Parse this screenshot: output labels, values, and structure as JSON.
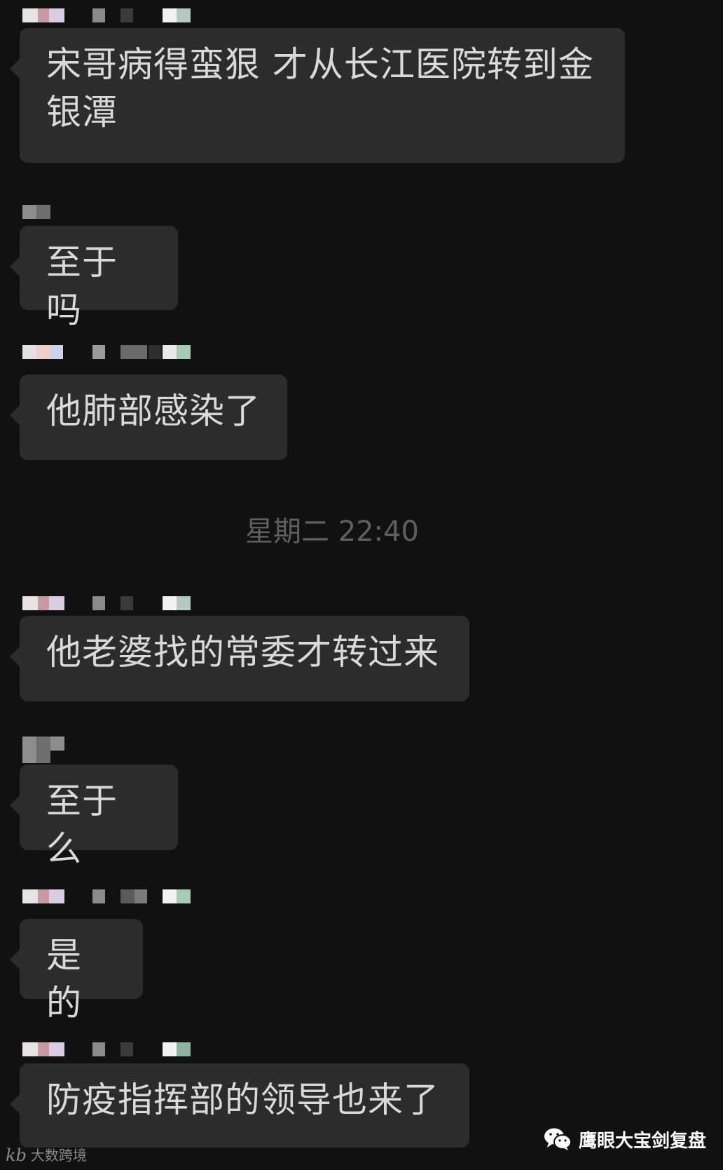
{
  "messages": [
    {
      "text": "宋哥病得蛮狠 才从长江医院转到金\n银潭"
    },
    {
      "text": "至于吗"
    },
    {
      "text": "他肺部感染了"
    },
    {
      "text": "他老婆找的常委才转过来"
    },
    {
      "text": "至于么"
    },
    {
      "text": "是的"
    },
    {
      "text": "防疫指挥部的领导也来了"
    }
  ],
  "timestamp": "星期二 22:40",
  "watermarks": {
    "left_logo": "kb",
    "left_text": "大数跨境",
    "right_text": "鹰眼大宝剑复盘"
  },
  "colors": {
    "background": "#111111",
    "bubble": "#2c2c2c",
    "bubble_text": "#d9d9d9",
    "timestamp_text": "#5f5f5f"
  }
}
